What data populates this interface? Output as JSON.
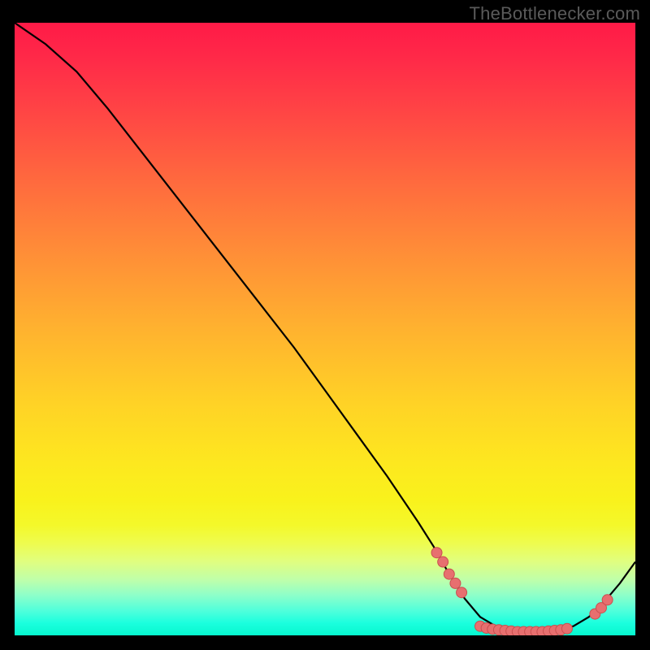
{
  "attribution": "TheBottlenecker.com",
  "chart_data": {
    "type": "line",
    "title": "",
    "xlabel": "",
    "ylabel": "",
    "xlim": [
      0,
      100
    ],
    "ylim": [
      0,
      100
    ],
    "curve": [
      {
        "x": 0.0,
        "y": 100.0
      },
      {
        "x": 5.0,
        "y": 96.5
      },
      {
        "x": 10.0,
        "y": 92.0
      },
      {
        "x": 15.0,
        "y": 86.0
      },
      {
        "x": 20.0,
        "y": 79.5
      },
      {
        "x": 25.0,
        "y": 73.0
      },
      {
        "x": 30.0,
        "y": 66.5
      },
      {
        "x": 35.0,
        "y": 60.0
      },
      {
        "x": 40.0,
        "y": 53.5
      },
      {
        "x": 45.0,
        "y": 47.0
      },
      {
        "x": 50.0,
        "y": 40.0
      },
      {
        "x": 55.0,
        "y": 33.0
      },
      {
        "x": 60.0,
        "y": 26.0
      },
      {
        "x": 65.0,
        "y": 18.5
      },
      {
        "x": 67.5,
        "y": 14.5
      },
      {
        "x": 70.0,
        "y": 10.0
      },
      {
        "x": 72.5,
        "y": 6.0
      },
      {
        "x": 75.0,
        "y": 3.0
      },
      {
        "x": 77.5,
        "y": 1.5
      },
      {
        "x": 80.0,
        "y": 0.8
      },
      {
        "x": 82.5,
        "y": 0.5
      },
      {
        "x": 85.0,
        "y": 0.5
      },
      {
        "x": 87.5,
        "y": 0.8
      },
      {
        "x": 90.0,
        "y": 1.5
      },
      {
        "x": 92.5,
        "y": 3.0
      },
      {
        "x": 95.0,
        "y": 5.5
      },
      {
        "x": 97.5,
        "y": 8.5
      },
      {
        "x": 100.0,
        "y": 12.0
      }
    ],
    "markers": [
      {
        "x": 68.0,
        "y": 13.5
      },
      {
        "x": 69.0,
        "y": 12.0
      },
      {
        "x": 70.0,
        "y": 10.0
      },
      {
        "x": 71.0,
        "y": 8.5
      },
      {
        "x": 72.0,
        "y": 7.0
      },
      {
        "x": 75.0,
        "y": 1.5
      },
      {
        "x": 76.0,
        "y": 1.2
      },
      {
        "x": 77.0,
        "y": 1.0
      },
      {
        "x": 78.0,
        "y": 0.9
      },
      {
        "x": 79.0,
        "y": 0.8
      },
      {
        "x": 80.0,
        "y": 0.7
      },
      {
        "x": 81.0,
        "y": 0.6
      },
      {
        "x": 82.0,
        "y": 0.6
      },
      {
        "x": 83.0,
        "y": 0.6
      },
      {
        "x": 84.0,
        "y": 0.6
      },
      {
        "x": 85.0,
        "y": 0.6
      },
      {
        "x": 86.0,
        "y": 0.7
      },
      {
        "x": 87.0,
        "y": 0.8
      },
      {
        "x": 88.0,
        "y": 0.9
      },
      {
        "x": 89.0,
        "y": 1.1
      },
      {
        "x": 93.5,
        "y": 3.5
      },
      {
        "x": 94.5,
        "y": 4.5
      },
      {
        "x": 95.5,
        "y": 5.8
      }
    ],
    "marker_color": "#e76f6f",
    "marker_stroke": "#c94f4f",
    "line_color": "#000000"
  }
}
